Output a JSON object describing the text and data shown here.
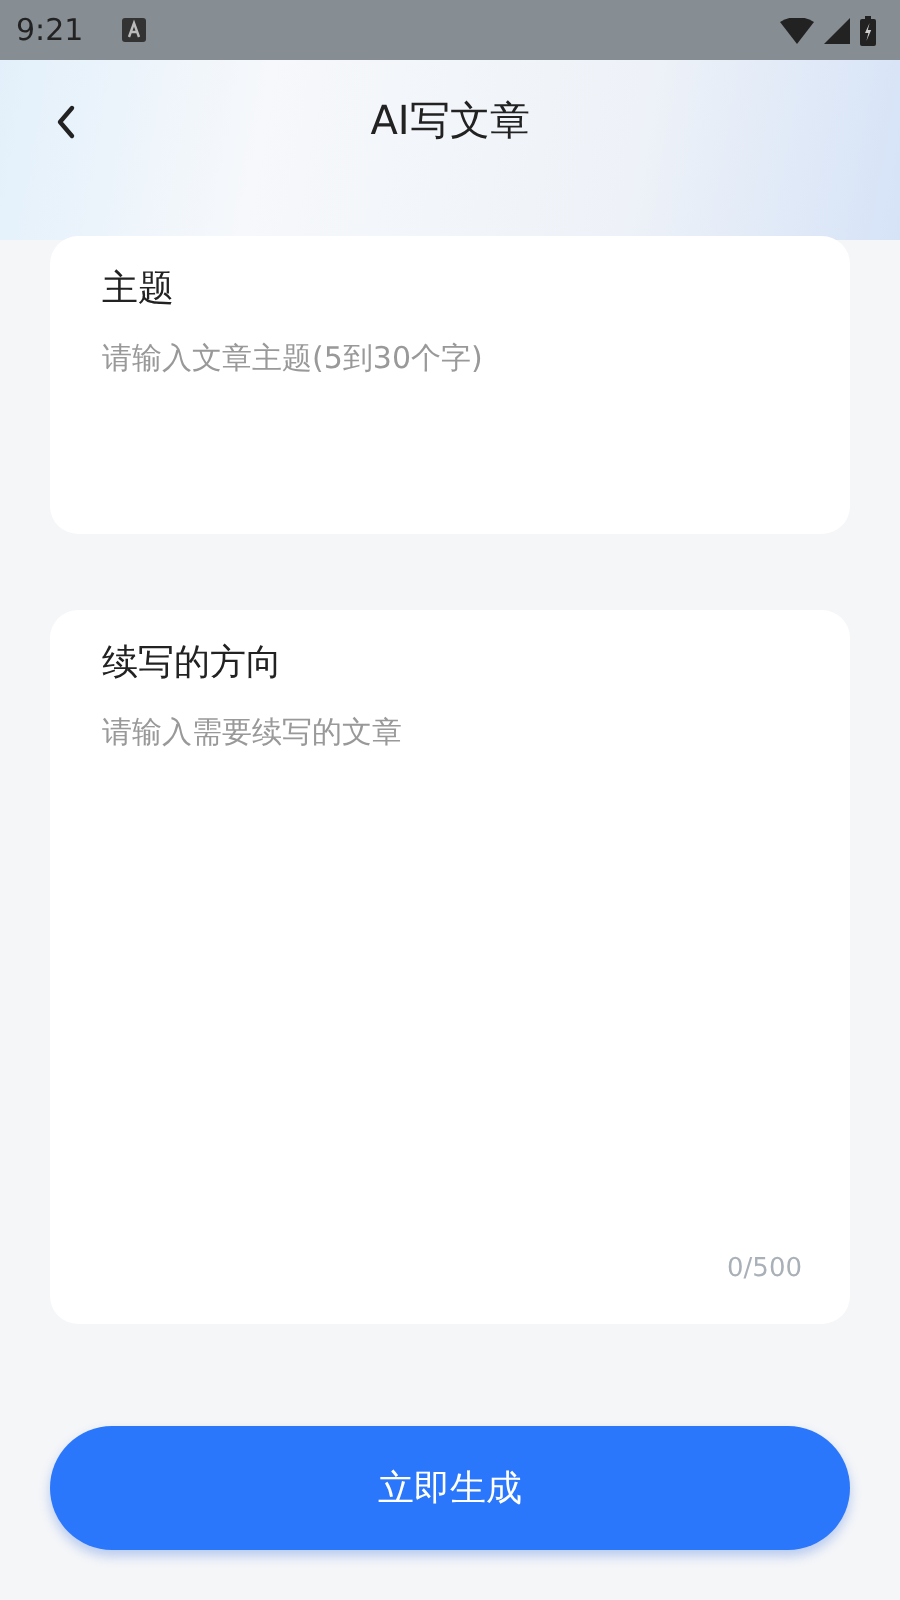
{
  "status_bar": {
    "time": "9:21"
  },
  "header": {
    "title": "AI写文章"
  },
  "topic": {
    "label": "主题",
    "placeholder": "请输入文章主题(5到30个字)"
  },
  "direction": {
    "label": "续写的方向",
    "placeholder": "请输入需要续写的文章",
    "counter": "0/500"
  },
  "submit_button": "立即生成"
}
